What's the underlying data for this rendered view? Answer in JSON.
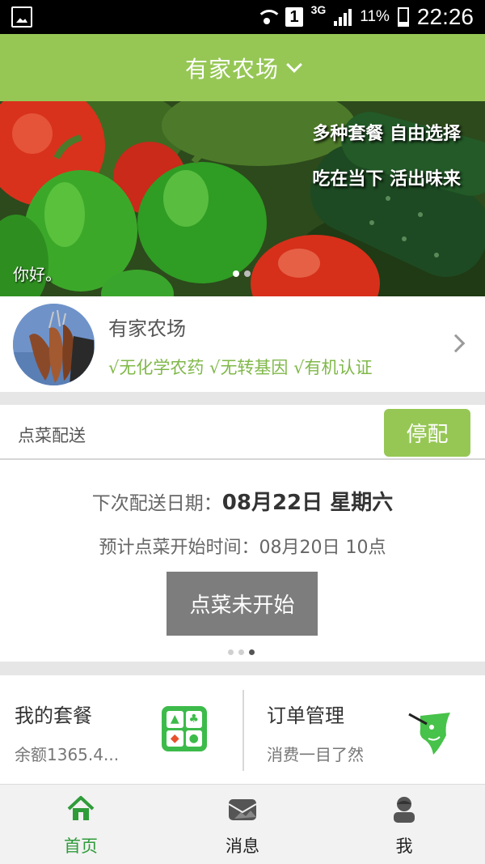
{
  "status_bar": {
    "sim_slot": "1",
    "network": "3G",
    "battery": "11%",
    "time": "22:26"
  },
  "header": {
    "title": "有家农场"
  },
  "banner": {
    "line1": "多种套餐 自由选择",
    "line2": "吃在当下 活出味来",
    "greeting": "你好。",
    "page_index": 1,
    "page_count": 2
  },
  "farm": {
    "name": "有家农场",
    "tags": "√无化学农药 √无转基因 √有机认证"
  },
  "delivery": {
    "title": "点菜配送",
    "stop_label": "停配",
    "next_label": "下次配送日期：",
    "next_value": "08月22日 星期六",
    "estimate": "预计点菜开始时间：08月20日 10点",
    "order_button": "点菜未开始",
    "page_index": 3,
    "page_count": 3
  },
  "cards": {
    "package": {
      "title": "我的套餐",
      "subtitle": "余额1365.4..."
    },
    "orders": {
      "title": "订单管理",
      "subtitle": "消费一目了然"
    }
  },
  "tabs": [
    {
      "label": "首页",
      "icon": "home-icon",
      "active": true
    },
    {
      "label": "消息",
      "icon": "message-icon",
      "active": false
    },
    {
      "label": "我",
      "icon": "user-icon",
      "active": false
    }
  ],
  "colors": {
    "brand_green": "#96c755",
    "tag_green": "#80b84a",
    "active_tab_green": "#2f9c3a",
    "disabled_gray": "#7d7d7d"
  }
}
